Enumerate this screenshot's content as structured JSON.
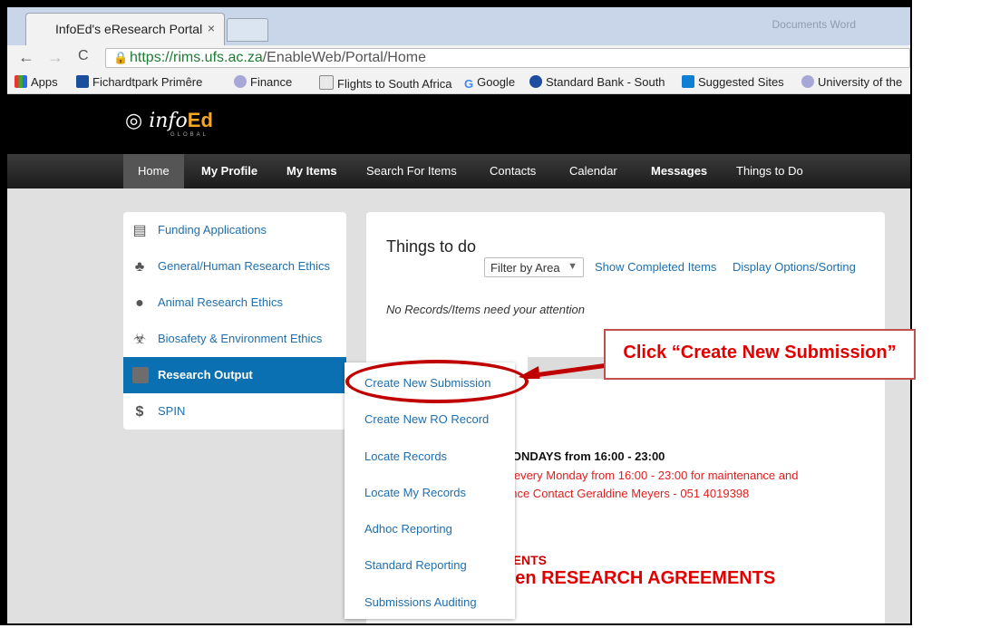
{
  "browser": {
    "tab_title": "InfoEd's eResearch Portal",
    "tab_close": "×",
    "ghost_text": "Documents   Word",
    "nav": {
      "back": "←",
      "forward": "→",
      "reload": "C"
    },
    "url_host": "https://rims.ufs.ac.za",
    "url_path": "/EnableWeb/Portal/Home",
    "bookmarks": [
      "Apps",
      "Fichardtpark Primêre",
      "Finance",
      "Flights to South Africa",
      "Google",
      "Standard Bank - South",
      "Suggested Sites",
      "University of the"
    ]
  },
  "site": {
    "logo_main": "info",
    "logo_ed": "Ed",
    "logo_sub": "GLOBAL",
    "nav": [
      "Home",
      "My Profile",
      "My Items",
      "Search For Items",
      "Contacts",
      "Calendar",
      "Messages",
      "Things to Do"
    ]
  },
  "sidebar": {
    "items": [
      {
        "label": "Funding Applications",
        "icon": "document-icon"
      },
      {
        "label": "General/Human Research Ethics",
        "icon": "people-icon"
      },
      {
        "label": "Animal Research Ethics",
        "icon": "paw-icon"
      },
      {
        "label": "Biosafety & Environment Ethics",
        "icon": "biohazard-icon"
      },
      {
        "label": "Research Output",
        "icon": "folder-icon"
      },
      {
        "label": "SPIN",
        "icon": "dollar-icon"
      }
    ]
  },
  "panel": {
    "title": "Things to do",
    "filter": "Filter by Area",
    "filter_arrow": "▼",
    "show_completed": "Show Completed Items",
    "display_options": "Display Options/Sorting",
    "no_records": "No Records/Items need your attention",
    "maint_heading": "MONDAYS from 16:00 - 23:00",
    "maint_line1": "n every Monday from 16:00 - 23:00 for maintenance and",
    "maint_line2": "ance Contact Geraldine Meyers - 051 4019398",
    "ann_heading": "MENTS",
    "ann_line": "pen RESEARCH AGREEMENTS"
  },
  "menu": {
    "items": [
      "Create New Submission",
      "Create New RO Record",
      "Locate Records",
      "Locate My Records",
      "Adhoc Reporting",
      "Standard Reporting",
      "Submissions Auditing"
    ]
  },
  "callout": {
    "text": "Click “Create New Submission”"
  },
  "colors": {
    "accent": "#0a70b1",
    "link": "#1f6fad",
    "annotation": "#c00000"
  }
}
